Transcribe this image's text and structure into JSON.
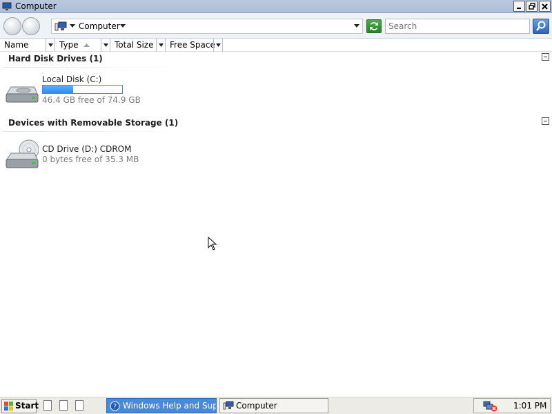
{
  "window": {
    "title": "Computer",
    "controls": {
      "minimize": "minimize",
      "maximize": "maximize",
      "close": "close"
    }
  },
  "navbar": {
    "address_crumb": "Computer",
    "search_placeholder": "Search"
  },
  "columns": [
    {
      "label": "Name"
    },
    {
      "label": "Type"
    },
    {
      "label": "Total Size"
    },
    {
      "label": "Free Space"
    }
  ],
  "groups": {
    "hard_disks": {
      "title": "Hard Disk Drives (1)",
      "item": {
        "name": "Local Disk (C:)",
        "detail": "46.4 GB free of 74.9 GB",
        "used_fraction": 0.38
      }
    },
    "removable": {
      "title": "Devices with Removable Storage (1)",
      "item": {
        "name": "CD Drive (D:) CDROM",
        "detail": "0 bytes free of 35.3 MB"
      }
    }
  },
  "taskbar": {
    "start_label": "Start",
    "tasks": [
      {
        "label": "Windows Help and Sup..."
      },
      {
        "label": "Computer"
      }
    ],
    "clock": "1:01 PM"
  },
  "colors": {
    "accent": "#4a88d9",
    "usage_bar": "#2a8af0",
    "titlebar": "#b9c8de"
  }
}
